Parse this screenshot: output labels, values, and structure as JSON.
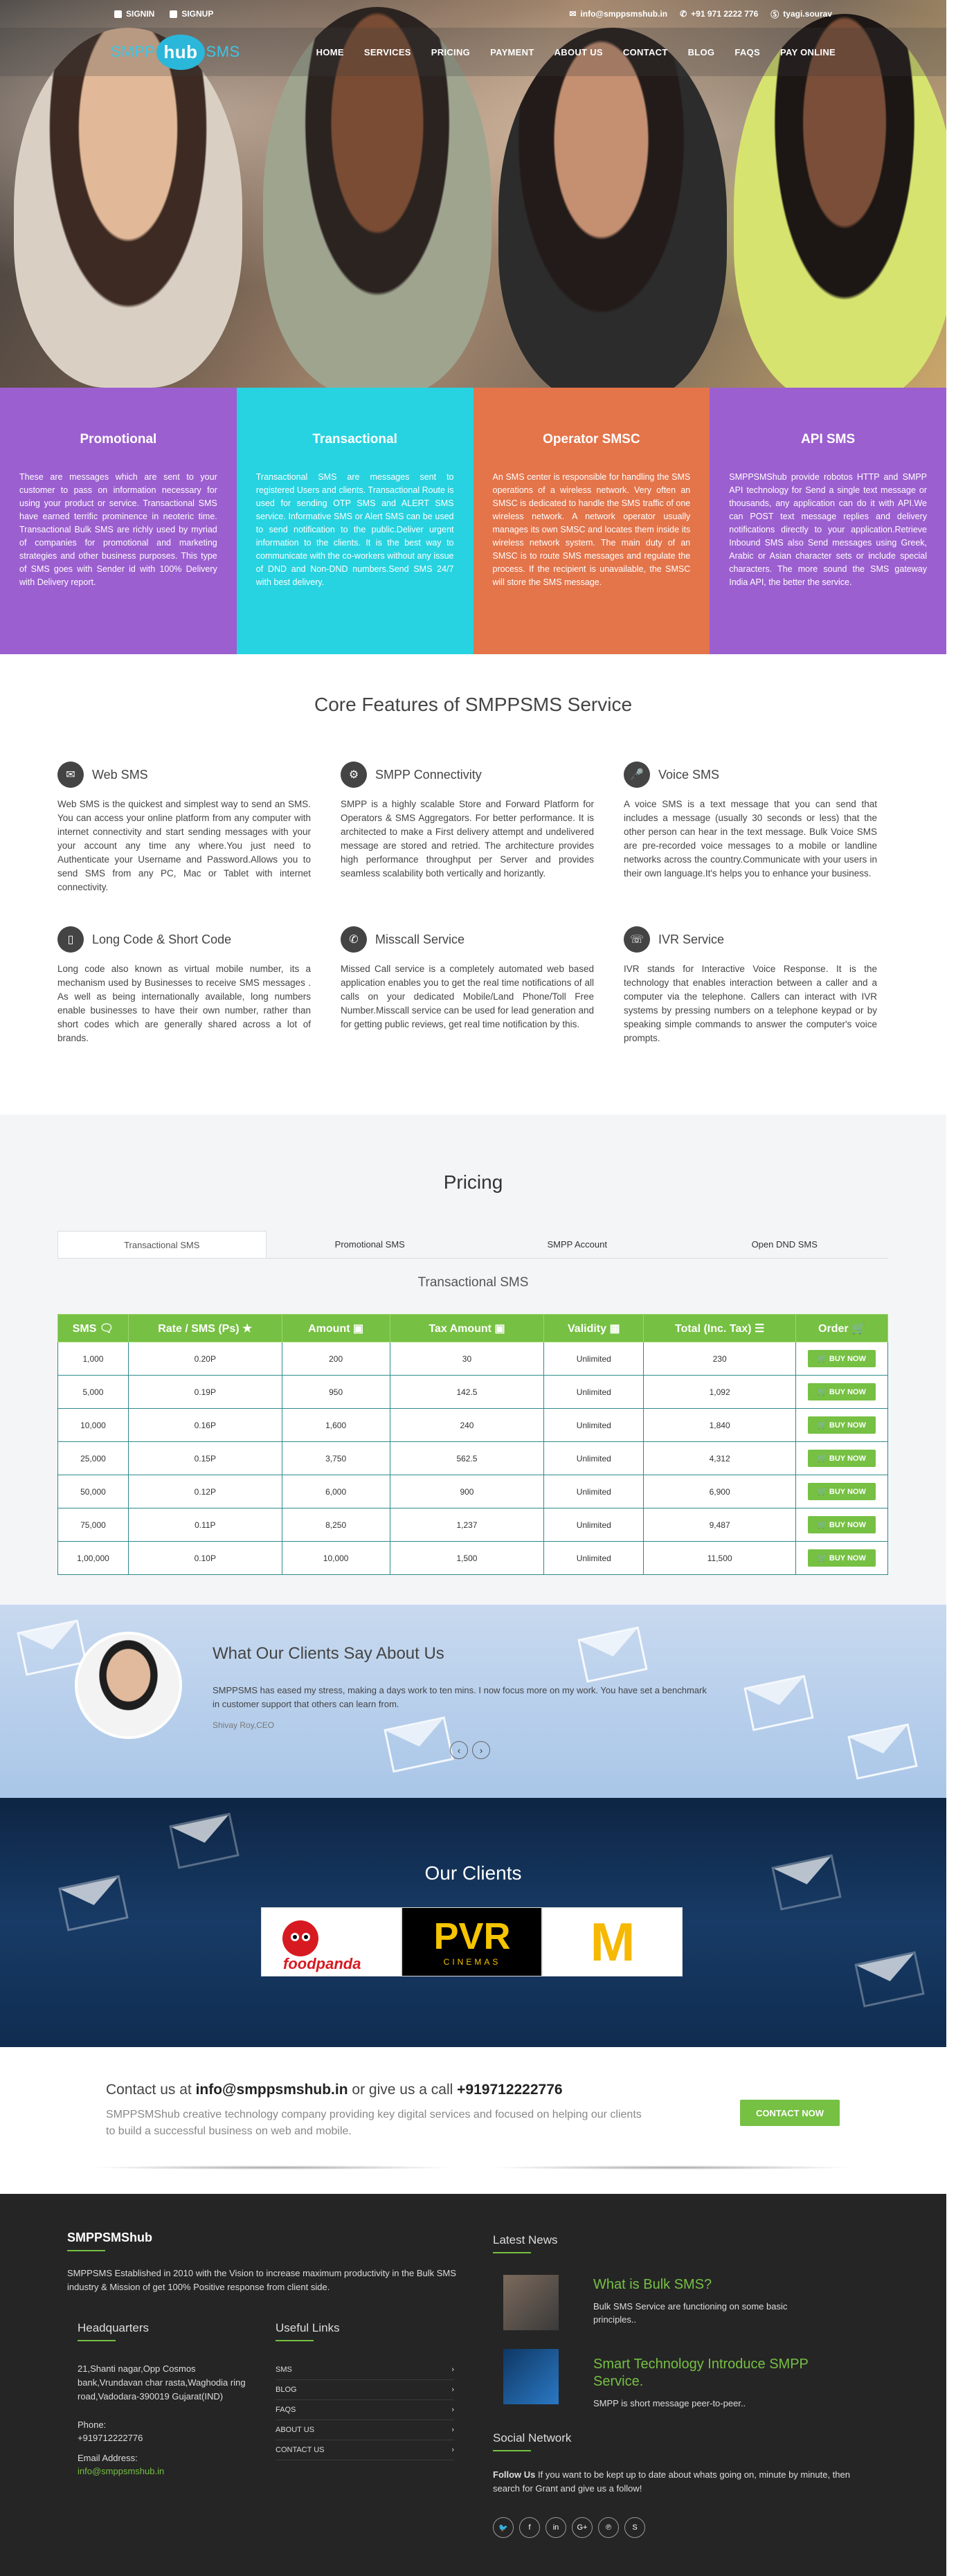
{
  "topbar": {
    "signin": "SIGNIN",
    "signup": "SIGNUP",
    "email": "info@smppsmshub.in",
    "phone": "+91 971 2222 776",
    "skype": "tyagi.sourav"
  },
  "logo": {
    "pre": "SMPP",
    "mid": "hub",
    "post": "SMS"
  },
  "nav": [
    "HOME",
    "SERVICES",
    "PRICING",
    "PAYMENT",
    "ABOUT US",
    "CONTACT",
    "BLOG",
    "FAQS",
    "PAY ONLINE"
  ],
  "services": [
    {
      "title": "Promotional",
      "color": "#9c5fd0",
      "text": "These are messages which are sent to your customer to pass on information necessary for using your product or service. Transactional SMS have earned terrific prominence in neoteric time. Transactional Bulk SMS are richly used by myriad of companies for promotional and marketing strategies and other business purposes. This type of SMS goes with Sender id with 100% Delivery with Delivery report."
    },
    {
      "title": "Transactional",
      "color": "#27d3e0",
      "text": "Transactional SMS are messages sent to registered Users and clients. Transactional Route is used for sending OTP SMS and ALERT SMS service. Informative SMS or Alert SMS can be used to send notification to the public.Deliver urgent information to the clients. It is the best way to communicate with the co-workers without any issue of DND and Non-DND numbers.Send SMS 24/7 with best delivery."
    },
    {
      "title": "Operator SMSC",
      "color": "#e4744a",
      "text": "An SMS center is responsible for handling the SMS operations of a wireless network. Very often an SMSC is dedicated to handle the SMS traffic of one wireless network. A network operator usually manages its own SMSC and locates them inside its wireless network system. The main duty of an SMSC is to route SMS messages and regulate the process. If the recipient is unavailable, the SMSC will store the SMS message."
    },
    {
      "title": "API SMS",
      "color": "#9c5fd0",
      "text": "SMPPSMShub provide robotos HTTP and SMPP API technology for Send a single text message or thousands, any application can do it with API.We can POST text message replies and delivery notifications directly to your application.Retrieve Inbound SMS also Send messages using Greek, Arabic or Asian character sets or include special characters. The more sound the SMS gateway India API, the better the service."
    }
  ],
  "core": {
    "title": "Core Features of SMPPSMS Service",
    "items": [
      {
        "name": "Web SMS",
        "icon": "envelope-icon",
        "glyph": "✉",
        "text": "Web SMS is the quickest and simplest way to send an SMS. You can access your online platform from any computer with internet connectivity and start sending messages with your your account any time any where.You just need to Authenticate your Username and Password.Allows you to send SMS from any PC, Mac or Tablet with internet connectivity."
      },
      {
        "name": "SMPP Connectivity",
        "icon": "gear-icon",
        "glyph": "⚙",
        "text": "SMPP is a highly scalable Store and Forward Platform for Operators & SMS Aggregators. For better performance. It is architected to make a First delivery attempt and undelivered message are stored and retried. The architecture provides high performance throughput per Server and provides seamless scalability both vertically and horizantly."
      },
      {
        "name": "Voice SMS",
        "icon": "microphone-icon",
        "glyph": "🎤",
        "text": "A voice SMS is a text message that you can send that includes a message (usually 30 seconds or less) that the other person can hear in the text message. Bulk Voice SMS are pre-recorded voice messages to a mobile or landline networks across the country.Communicate with your users in their own language.It's helps you to enhance your business."
      },
      {
        "name": "Long Code & Short Code",
        "icon": "mobile-icon",
        "glyph": "▯",
        "text": "Long code also known as virtual mobile number, its a mechanism used by Businesses to receive SMS messages . As well as being internationally available, long numbers enable businesses to have their own number, rather than short codes which are generally shared across a lot of brands."
      },
      {
        "name": "Misscall Service",
        "icon": "phone-icon",
        "glyph": "✆",
        "text": "Missed Call service is a completely automated web based application enables you to get the real time notifications of all calls on your dedicated Mobile/Land Phone/Toll Free Number.Misscall service can be used for lead generation and for getting public reviews, get real time notification by this."
      },
      {
        "name": "IVR Service",
        "icon": "phone-volume-icon",
        "glyph": "☏",
        "text": "IVR stands for Interactive Voice Response. It is the technology that enables interaction between a caller and a computer via the telephone. Callers can interact with IVR systems by pressing numbers on a telephone keypad or by speaking simple commands to answer the computer's voice prompts."
      }
    ]
  },
  "pricing": {
    "title": "Pricing",
    "tabs": [
      "Transactional SMS",
      "Promotional SMS",
      "SMPP Account",
      "Open DND SMS"
    ],
    "subtitle": "Transactional SMS",
    "headers": [
      "SMS 🗨",
      "Rate / SMS (Ps) ★",
      "Amount ▣",
      "Tax Amount ▣",
      "Validity ▦",
      "Total (Inc. Tax) ☰",
      "Order 🛒"
    ],
    "buy_label": "🛒 BUY NOW",
    "rows": [
      [
        "1,000",
        "0.20P",
        "200",
        "30",
        "Unlimited",
        "230"
      ],
      [
        "5,000",
        "0.19P",
        "950",
        "142.5",
        "Unlimited",
        "1,092"
      ],
      [
        "10,000",
        "0.16P",
        "1,600",
        "240",
        "Unlimited",
        "1,840"
      ],
      [
        "25,000",
        "0.15P",
        "3,750",
        "562.5",
        "Unlimited",
        "4,312"
      ],
      [
        "50,000",
        "0.12P",
        "6,000",
        "900",
        "Unlimited",
        "6,900"
      ],
      [
        "75,000",
        "0.11P",
        "8,250",
        "1,237",
        "Unlimited",
        "9,487"
      ],
      [
        "1,00,000",
        "0.10P",
        "10,000",
        "1,500",
        "Unlimited",
        "11,500"
      ]
    ]
  },
  "testimonial": {
    "title": "What Our Clients Say About Us",
    "text": "SMPPSMS has eased my stress, making a days work to ten mins. I now focus more on my work. You have set a benchmark in customer support that others can learn from.",
    "author": "Shivay Roy,CEO",
    "prev": "‹",
    "next": "›"
  },
  "clients": {
    "title": "Our Clients",
    "logos": [
      "foodpanda",
      "PVR",
      "CINEMAS",
      "M"
    ]
  },
  "contact": {
    "prefix": "Contact us at",
    "email": "info@smppsmshub.in",
    "middle": "or give us a call",
    "phone": "+919712222776",
    "sub": "SMPPSMShub creative technology company providing key digital services and focused on helping our clients to build a successful business on web and mobile.",
    "button": "CONTACT NOW"
  },
  "footer": {
    "brand": "SMPPSMShub",
    "about": "SMPPSMS Established in 2010 with the Vision to increase maximum productivity in the Bulk SMS industry & Mission of get 100% Positive response from client side.",
    "hq_title": "Headquarters",
    "address": "21,Shanti nagar,Opp Cosmos bank,Vrundavan char rasta,Waghodia ring road,Vadodara-390019 Gujarat(IND)",
    "phone_label": "Phone:",
    "phone": "+919712222776",
    "email_label": "Email Address:",
    "email": "info@smppsmshub.in",
    "links_title": "Useful Links",
    "links": [
      "SMS",
      "BLOG",
      "FAQS",
      "ABOUT US",
      "CONTACT US"
    ],
    "news_title": "Latest News",
    "news": [
      {
        "title": "What is Bulk SMS?",
        "text": "Bulk SMS Service are functioning on some basic principles.."
      },
      {
        "title": "Smart Technology Introduce SMPP Service.",
        "text": "SMPP is short message peer-to-peer.."
      }
    ],
    "social_title": "Social Network",
    "follow_bold": "Follow Us",
    "follow_text": "If you want to be kept up to date about whats going on, minute by minute, then search for Grant and give us a follow!",
    "social": [
      "🐦",
      "f",
      "in",
      "G+",
      "℗",
      "S"
    ]
  }
}
